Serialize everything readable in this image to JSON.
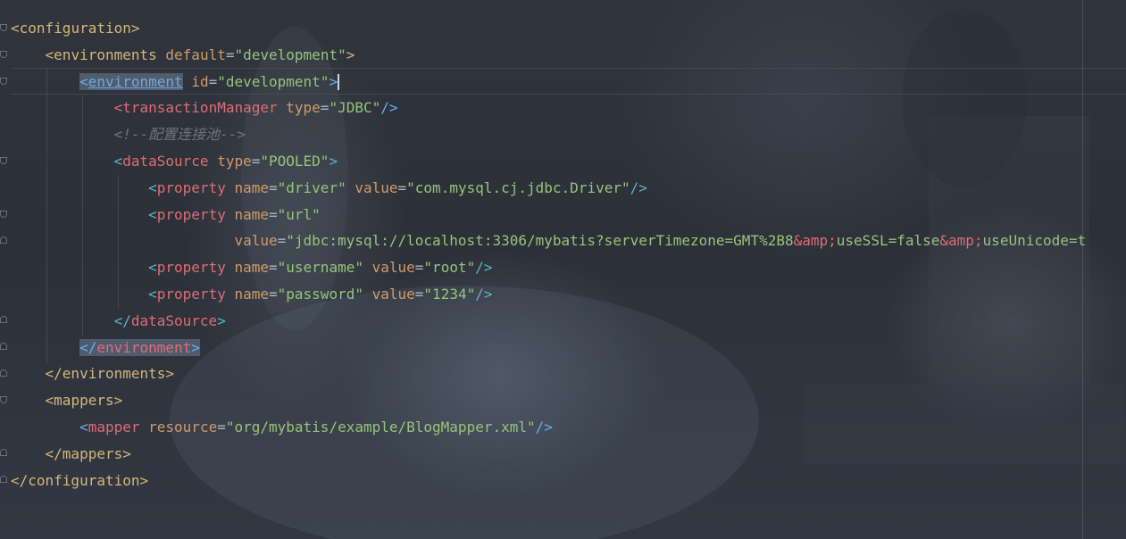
{
  "editor": {
    "lines": [
      [
        {
          "t": "<",
          "c": "tb"
        },
        {
          "t": "configuration",
          "c": "tb"
        },
        {
          "t": ">",
          "c": "tb"
        }
      ],
      [
        {
          "t": "    "
        },
        {
          "t": "<",
          "c": "tb"
        },
        {
          "t": "environments",
          "c": "tb"
        },
        {
          "t": " "
        },
        {
          "t": "default",
          "c": "at"
        },
        {
          "t": "=",
          "c": "br"
        },
        {
          "t": "\"development\"",
          "c": "st"
        },
        {
          "t": ">",
          "c": "tb"
        }
      ],
      [
        {
          "t": "        "
        },
        {
          "t": "<",
          "c": "blue hl"
        },
        {
          "t": "environment",
          "c": "ul hl"
        },
        {
          "t": " "
        },
        {
          "t": "id",
          "c": "at"
        },
        {
          "t": "=",
          "c": "br"
        },
        {
          "t": "\"development\"",
          "c": "st"
        },
        {
          "t": ">",
          "c": "blue"
        }
      ],
      [
        {
          "t": "            "
        },
        {
          "t": "<",
          "c": "tg"
        },
        {
          "t": "transactionManager",
          "c": "tg"
        },
        {
          "t": " "
        },
        {
          "t": "type",
          "c": "at"
        },
        {
          "t": "=",
          "c": "br"
        },
        {
          "t": "\"JDBC\"",
          "c": "st"
        },
        {
          "t": "/>",
          "c": "blue"
        }
      ],
      [
        {
          "t": "            "
        },
        {
          "t": "<!--配置连接池-->",
          "c": "cm"
        }
      ],
      [
        {
          "t": "            "
        },
        {
          "t": "<",
          "c": "tc"
        },
        {
          "t": "dataSource",
          "c": "tg"
        },
        {
          "t": " "
        },
        {
          "t": "type",
          "c": "at"
        },
        {
          "t": "=",
          "c": "br"
        },
        {
          "t": "\"POOLED\"",
          "c": "st"
        },
        {
          "t": ">",
          "c": "tc"
        }
      ],
      [
        {
          "t": "                "
        },
        {
          "t": "<",
          "c": "tc"
        },
        {
          "t": "property",
          "c": "tg"
        },
        {
          "t": " "
        },
        {
          "t": "name",
          "c": "at"
        },
        {
          "t": "=",
          "c": "br"
        },
        {
          "t": "\"driver\"",
          "c": "st"
        },
        {
          "t": " "
        },
        {
          "t": "value",
          "c": "at"
        },
        {
          "t": "=",
          "c": "br"
        },
        {
          "t": "\"com.mysql.cj.jdbc.Driver\"",
          "c": "st"
        },
        {
          "t": "/>",
          "c": "tc"
        }
      ],
      [
        {
          "t": "                "
        },
        {
          "t": "<",
          "c": "tc"
        },
        {
          "t": "property",
          "c": "tg"
        },
        {
          "t": " "
        },
        {
          "t": "name",
          "c": "at"
        },
        {
          "t": "=",
          "c": "br"
        },
        {
          "t": "\"url\"",
          "c": "st"
        }
      ],
      [
        {
          "t": "                          "
        },
        {
          "t": "value",
          "c": "at"
        },
        {
          "t": "=",
          "c": "br"
        },
        {
          "t": "\"jdbc:mysql://localhost:3306/mybatis?serverTimezone=GMT%2B8",
          "c": "st"
        },
        {
          "t": "&amp;",
          "c": "en"
        },
        {
          "t": "useSSL=false",
          "c": "st"
        },
        {
          "t": "&amp;",
          "c": "en"
        },
        {
          "t": "useUnicode=t",
          "c": "st"
        }
      ],
      [
        {
          "t": "                "
        },
        {
          "t": "<",
          "c": "tc"
        },
        {
          "t": "property",
          "c": "tg"
        },
        {
          "t": " "
        },
        {
          "t": "name",
          "c": "at"
        },
        {
          "t": "=",
          "c": "br"
        },
        {
          "t": "\"username\"",
          "c": "st"
        },
        {
          "t": " "
        },
        {
          "t": "value",
          "c": "at"
        },
        {
          "t": "=",
          "c": "br"
        },
        {
          "t": "\"root\"",
          "c": "st"
        },
        {
          "t": "/>",
          "c": "tc"
        }
      ],
      [
        {
          "t": "                "
        },
        {
          "t": "<",
          "c": "tc"
        },
        {
          "t": "property",
          "c": "tg"
        },
        {
          "t": " "
        },
        {
          "t": "name",
          "c": "at"
        },
        {
          "t": "=",
          "c": "br"
        },
        {
          "t": "\"password\"",
          "c": "st"
        },
        {
          "t": " "
        },
        {
          "t": "value",
          "c": "at"
        },
        {
          "t": "=",
          "c": "br"
        },
        {
          "t": "\"1234\"",
          "c": "st"
        },
        {
          "t": "/>",
          "c": "tc"
        }
      ],
      [
        {
          "t": "            "
        },
        {
          "t": "</",
          "c": "tc"
        },
        {
          "t": "dataSource",
          "c": "tg"
        },
        {
          "t": ">",
          "c": "tc"
        }
      ],
      [
        {
          "t": "        "
        },
        {
          "t": "</",
          "c": "blue hl"
        },
        {
          "t": "environment",
          "c": "tg hl"
        },
        {
          "t": ">",
          "c": "blue hl"
        }
      ],
      [
        {
          "t": "    "
        },
        {
          "t": "</",
          "c": "tb"
        },
        {
          "t": "environments",
          "c": "tb"
        },
        {
          "t": ">",
          "c": "tb"
        }
      ],
      [
        {
          "t": "    "
        },
        {
          "t": "<",
          "c": "tb"
        },
        {
          "t": "mappers",
          "c": "tb"
        },
        {
          "t": ">",
          "c": "tb"
        }
      ],
      [
        {
          "t": "        "
        },
        {
          "t": "<",
          "c": "blue"
        },
        {
          "t": "mapper",
          "c": "tg"
        },
        {
          "t": " "
        },
        {
          "t": "resource",
          "c": "at"
        },
        {
          "t": "=",
          "c": "br"
        },
        {
          "t": "\"org/mybatis/example/BlogMapper.xml\"",
          "c": "st"
        },
        {
          "t": "/>",
          "c": "blue"
        }
      ],
      [
        {
          "t": "    "
        },
        {
          "t": "</",
          "c": "tb"
        },
        {
          "t": "mappers",
          "c": "tb"
        },
        {
          "t": ">",
          "c": "tb"
        }
      ],
      [
        {
          "t": "</",
          "c": "tb"
        },
        {
          "t": "configuration",
          "c": "tb"
        },
        {
          "t": ">",
          "c": "tb"
        }
      ]
    ],
    "caret_line": 2
  },
  "colors": {
    "background": "#2b2f38",
    "tag": "#e06c75",
    "attribute": "#d19a66",
    "string": "#98c379",
    "comment": "#6e7580"
  }
}
